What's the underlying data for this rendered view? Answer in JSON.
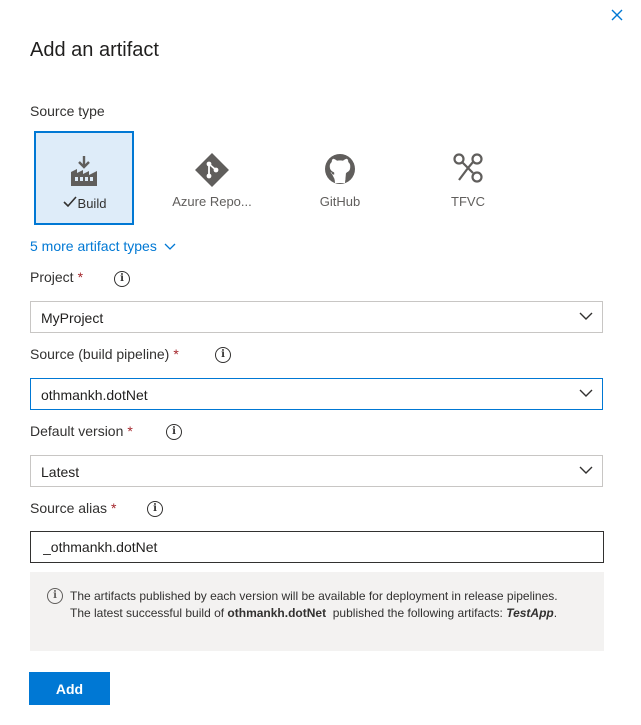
{
  "panel": {
    "title": "Add an artifact",
    "close_icon": "close-icon"
  },
  "source_type": {
    "label": "Source type",
    "tiles": [
      {
        "label": "Build",
        "icon": "build-icon",
        "selected": true,
        "check_icon": "checkmark-icon"
      },
      {
        "label": "Azure Repo...",
        "icon": "git-icon",
        "selected": false
      },
      {
        "label": "GitHub",
        "icon": "github-icon",
        "selected": false
      },
      {
        "label": "TFVC",
        "icon": "tfvc-icon",
        "selected": false
      }
    ],
    "more_link": "5 more artifact types"
  },
  "project": {
    "label": "Project",
    "required": "*",
    "value": "MyProject"
  },
  "source": {
    "label": "Source (build pipeline)",
    "required": "*",
    "value": "othmankh.dotNet"
  },
  "default_version": {
    "label": "Default version",
    "required": "*",
    "value": "Latest"
  },
  "source_alias": {
    "label": "Source alias",
    "required": "*",
    "value": "_othmankh.dotNet"
  },
  "notice": {
    "text_1": "The artifacts published by each version will be available for deployment in release pipelines. The latest successful build of ",
    "pipeline": "othmankh.dotNet",
    "text_2": "  published the following artifacts: ",
    "artifact": "TestApp",
    "text_3": "."
  },
  "actions": {
    "add_label": "Add"
  },
  "colors": {
    "accent": "#0078d4",
    "selected_tile_bg": "#deecf9",
    "required": "#a4262c",
    "notice_bg": "#f3f2f1"
  }
}
